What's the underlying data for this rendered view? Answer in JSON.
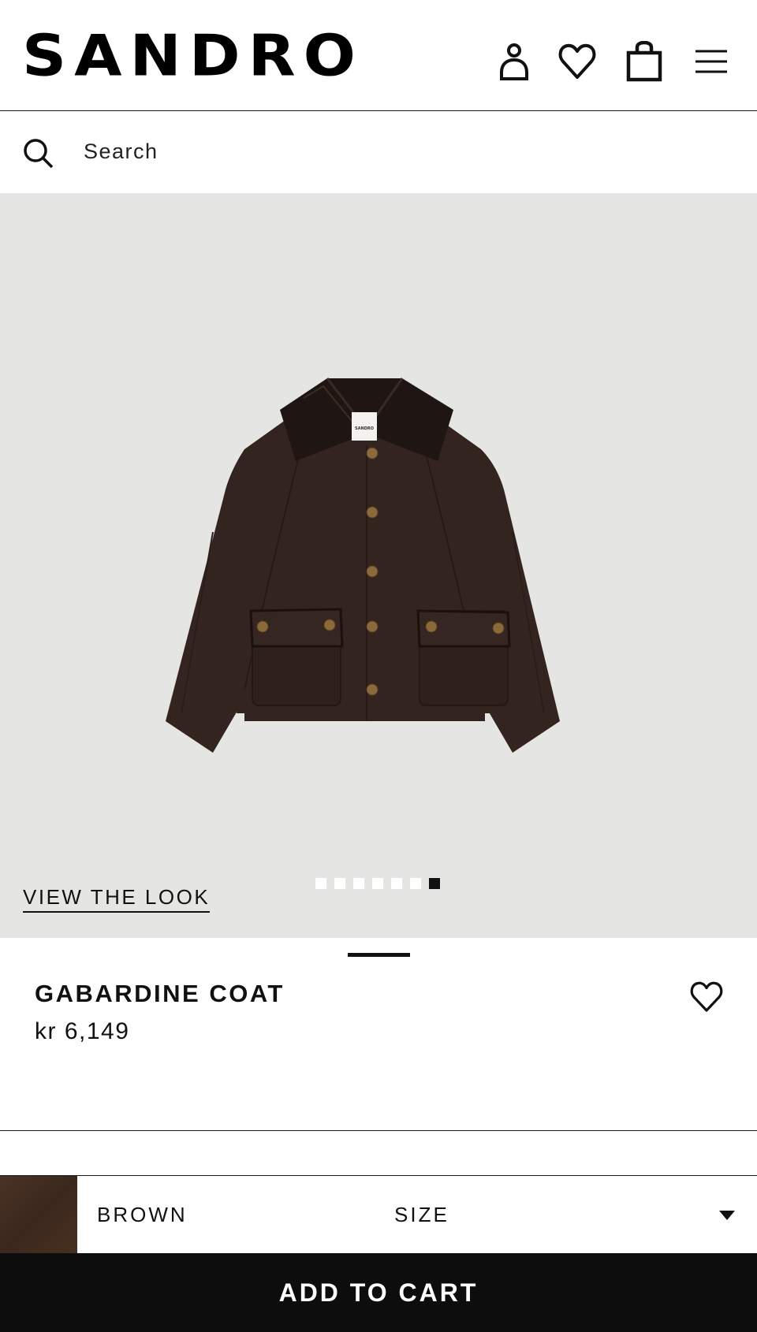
{
  "header": {
    "logo": "SANDRO",
    "icons": [
      "account-icon",
      "wishlist-icon",
      "bag-icon",
      "menu-icon"
    ]
  },
  "search": {
    "placeholder": "Search"
  },
  "gallery": {
    "image_alt": "Gabardine coat in brown with leather collar",
    "view_look": "VIEW THE LOOK",
    "dots_total": 7,
    "active_dot": 7
  },
  "product": {
    "name": "GABARDINE COAT",
    "price": "kr 6,149"
  },
  "selector": {
    "color_name": "BROWN",
    "color_hex": "#3f2b1f",
    "size_label": "SIZE"
  },
  "cta": {
    "add_to_cart": "ADD TO CART"
  },
  "colors": {
    "text": "#111111",
    "gallery_bg": "#e5e5e3",
    "button_bg": "#0d0d0d"
  }
}
